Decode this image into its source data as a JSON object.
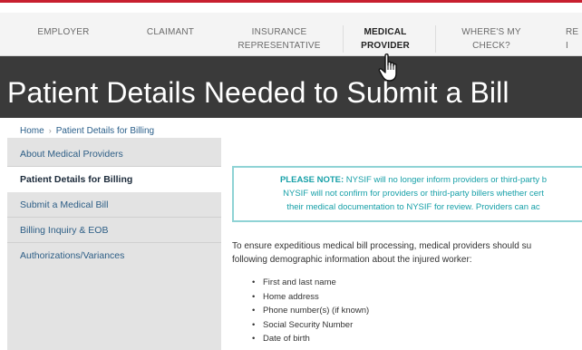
{
  "topnav": {
    "items": [
      {
        "label_1": "EMPLOYER",
        "label_2": "",
        "active": false
      },
      {
        "label_1": "CLAIMANT",
        "label_2": "",
        "active": false
      },
      {
        "label_1": "INSURANCE",
        "label_2": "REPRESENTATIVE",
        "active": false
      },
      {
        "label_1": "MEDICAL",
        "label_2": "PROVIDER",
        "active": true
      },
      {
        "label_1": "WHERE'S MY",
        "label_2": "CHECK?",
        "active": false
      },
      {
        "label_1": "RE",
        "label_2": "I",
        "active": false
      }
    ],
    "cursor_icon": "hand-pointer-icon"
  },
  "banner": {
    "title": "Patient Details Needed to Submit a Bill"
  },
  "breadcrumb": {
    "home": "Home",
    "separator": "›",
    "current": "Patient Details for Billing"
  },
  "sidebar": {
    "items": [
      {
        "label": "About Medical Providers",
        "active": false
      },
      {
        "label": "Patient Details for Billing",
        "active": true
      },
      {
        "label": "Submit a Medical Bill",
        "active": false
      },
      {
        "label": "Billing Inquiry & EOB",
        "active": false
      },
      {
        "label": "Authorizations/Variances",
        "active": false
      }
    ]
  },
  "note": {
    "heading": "PLEASE NOTE:",
    "line1_rest": " NYSIF will no longer inform providers or third-party b",
    "line2": "NYSIF will not confirm for providers or third-party billers whether cert",
    "line3": "their medical documentation to NYSIF for review. Providers can ac"
  },
  "content": {
    "intro_line1": "To ensure expeditious medical bill processing, medical providers should su",
    "intro_line2": "following demographic information about the injured worker:",
    "bullets": [
      "First and last name",
      "Home address",
      "Phone number(s) (if known)",
      "Social Security Number",
      "Date of birth"
    ]
  },
  "colors": {
    "accent_red": "#c8202f",
    "banner_bg": "#3a3a3a",
    "link_blue": "#2b5f8a",
    "note_teal": "#17a0a8",
    "note_border": "#8fd3d5",
    "sidebar_bg": "#e3e3e3"
  }
}
